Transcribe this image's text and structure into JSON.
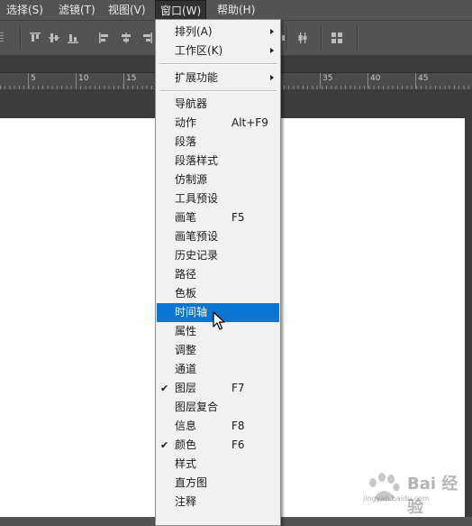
{
  "menubar": {
    "items": [
      {
        "label": "选择(S)"
      },
      {
        "label": "滤镜(T)"
      },
      {
        "label": "视图(V)"
      },
      {
        "label": "窗口(W)"
      },
      {
        "label": "帮助(H)"
      }
    ]
  },
  "ruler": {
    "labels": [
      "5",
      "10",
      "15",
      "35",
      "40",
      "45"
    ]
  },
  "window_menu": {
    "items": [
      {
        "label": "排列(A)",
        "submenu": true
      },
      {
        "label": "工作区(K)",
        "submenu": true
      },
      {
        "label": "扩展功能",
        "submenu": true
      },
      {
        "label": "导航器"
      },
      {
        "label": "动作",
        "shortcut": "Alt+F9"
      },
      {
        "label": "段落"
      },
      {
        "label": "段落样式"
      },
      {
        "label": "仿制源"
      },
      {
        "label": "工具预设"
      },
      {
        "label": "画笔",
        "shortcut": "F5"
      },
      {
        "label": "画笔预设"
      },
      {
        "label": "历史记录"
      },
      {
        "label": "路径"
      },
      {
        "label": "色板"
      },
      {
        "label": "时间轴",
        "selected": true
      },
      {
        "label": "属性"
      },
      {
        "label": "调整"
      },
      {
        "label": "通道"
      },
      {
        "label": "图层",
        "shortcut": "F7",
        "checked": true
      },
      {
        "label": "图层复合"
      },
      {
        "label": "信息",
        "shortcut": "F8"
      },
      {
        "label": "颜色",
        "shortcut": "F6",
        "checked": true
      },
      {
        "label": "样式"
      },
      {
        "label": "直方图"
      },
      {
        "label": "注释"
      }
    ],
    "check_glyph": "✔"
  },
  "watermark": {
    "text": "Bai 经验",
    "sub": "jingyan.baidu.com"
  },
  "colors": {
    "highlight": "#0a76d2",
    "menu_bg": "#f1f1f1",
    "chrome": "#535353"
  }
}
